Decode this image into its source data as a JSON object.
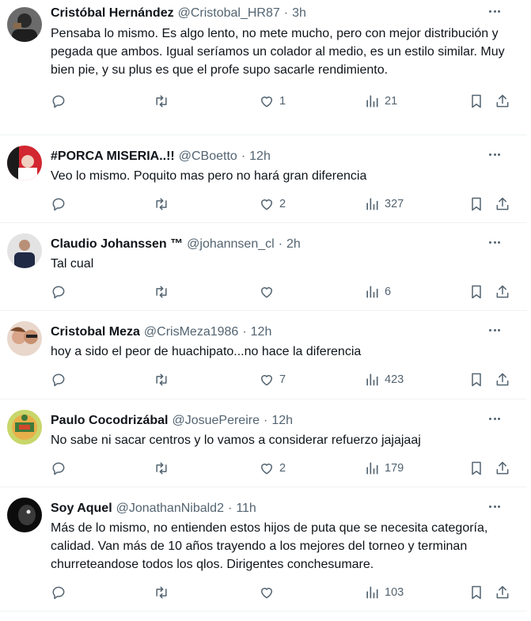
{
  "tweets": [
    {
      "name": "Cristóbal Hernández",
      "handle": "@Cristobal_HR87",
      "time": "3h",
      "text": "Pensaba lo mismo. Es algo lento, no mete mucho, pero con mejor distribución y pegada que ambos. Igual seríamos un colador al medio, es un estilo similar. Muy bien pie, y su plus es que el profe supo sacarle rendimiento.",
      "replies": "",
      "retweets": "",
      "likes": "1",
      "views": "21",
      "avatar_color": "#3a3a3a"
    },
    {
      "name": "#PORCA MISERIA..!!",
      "handle": "@CBoetto",
      "time": "12h",
      "text": "Veo lo mismo. Poquito mas pero no hará gran diferencia",
      "replies": "",
      "retweets": "",
      "likes": "2",
      "views": "327",
      "avatar_color": "#c8202a"
    },
    {
      "name": "Claudio Johanssen ™",
      "handle": "@johannsen_cl",
      "time": "2h",
      "text": "Tal cual",
      "replies": "",
      "retweets": "",
      "likes": "",
      "views": "6",
      "avatar_color": "#d9d9d9"
    },
    {
      "name": "Cristobal Meza",
      "handle": "@CrisMeza1986",
      "time": "12h",
      "text": "hoy a sido el peor de huachipato...no hace la diferencia",
      "replies": "",
      "retweets": "",
      "likes": "7",
      "views": "423",
      "avatar_color": "#e6b9a8"
    },
    {
      "name": "Paulo Cocodrizábal",
      "handle": "@JosuePereire",
      "time": "12h",
      "text": "No sabe ni sacar centros y lo vamos a considerar refuerzo jajajaaj",
      "replies": "",
      "retweets": "",
      "likes": "2",
      "views": "179",
      "avatar_color": "#8fb83a"
    },
    {
      "name": "Soy Aquel",
      "handle": "@JonathanNibald2",
      "time": "11h",
      "text": "Más de lo mismo, no entienden estos hijos de puta que se necesita categoría, calidad. Van más de 10 años trayendo a los mejores del torneo y terminan churreteandose todos los qlos. Dirigentes conchesumare.",
      "replies": "",
      "retweets": "",
      "likes": "",
      "views": "103",
      "avatar_color": "#111111"
    }
  ],
  "separator": "·",
  "colors": {
    "text": "#0f1419",
    "secondary": "#536471",
    "border": "#eff3f4"
  },
  "icons": [
    "reply-icon",
    "retweet-icon",
    "like-icon",
    "views-icon",
    "bookmark-icon",
    "share-icon",
    "more-icon"
  ]
}
